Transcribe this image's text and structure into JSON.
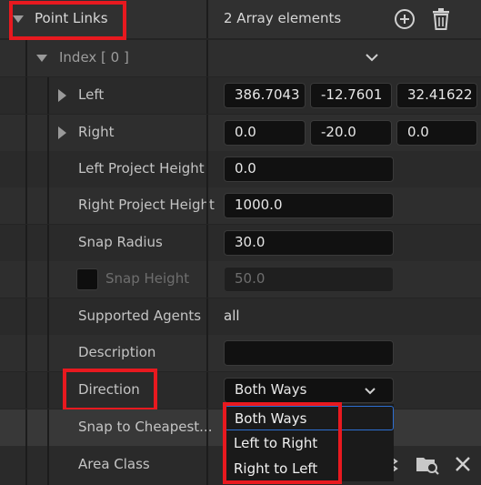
{
  "header": {
    "title": "Point Links",
    "count": "2 Array elements",
    "add_icon": "plus-circle-icon",
    "delete_icon": "trash-icon"
  },
  "index_row": {
    "label": "Index [ 0 ]",
    "expand_icon": "chevron-down-icon"
  },
  "rows": {
    "left": {
      "label": "Left",
      "x": "386.7043",
      "y": "-12.7601",
      "z": "32.41622"
    },
    "right": {
      "label": "Right",
      "x": "0.0",
      "y": "-20.0",
      "z": "0.0"
    },
    "left_project_height": {
      "label": "Left Project Height",
      "value": "0.0"
    },
    "right_project_height": {
      "label": "Right Project Height",
      "value": "1000.0"
    },
    "snap_radius": {
      "label": "Snap Radius",
      "value": "30.0"
    },
    "snap_height": {
      "label": "Snap Height",
      "value": "50.0",
      "checked": false
    },
    "supported_agents": {
      "label": "Supported Agents",
      "value": "all"
    },
    "description": {
      "label": "Description",
      "value": ""
    },
    "direction": {
      "label": "Direction",
      "value": "Both Ways"
    },
    "snap_to_cheapest": {
      "label": "Snap to Cheapest..."
    },
    "area_class": {
      "label": "Area Class",
      "browse_icon": "browse-folder-icon",
      "clear_icon": "close-icon"
    }
  },
  "direction_menu": {
    "options": [
      "Both Ways",
      "Left to Right",
      "Right to Left"
    ]
  },
  "colors": {
    "highlight": "#e8191f",
    "accent": "#2d6fd2"
  }
}
